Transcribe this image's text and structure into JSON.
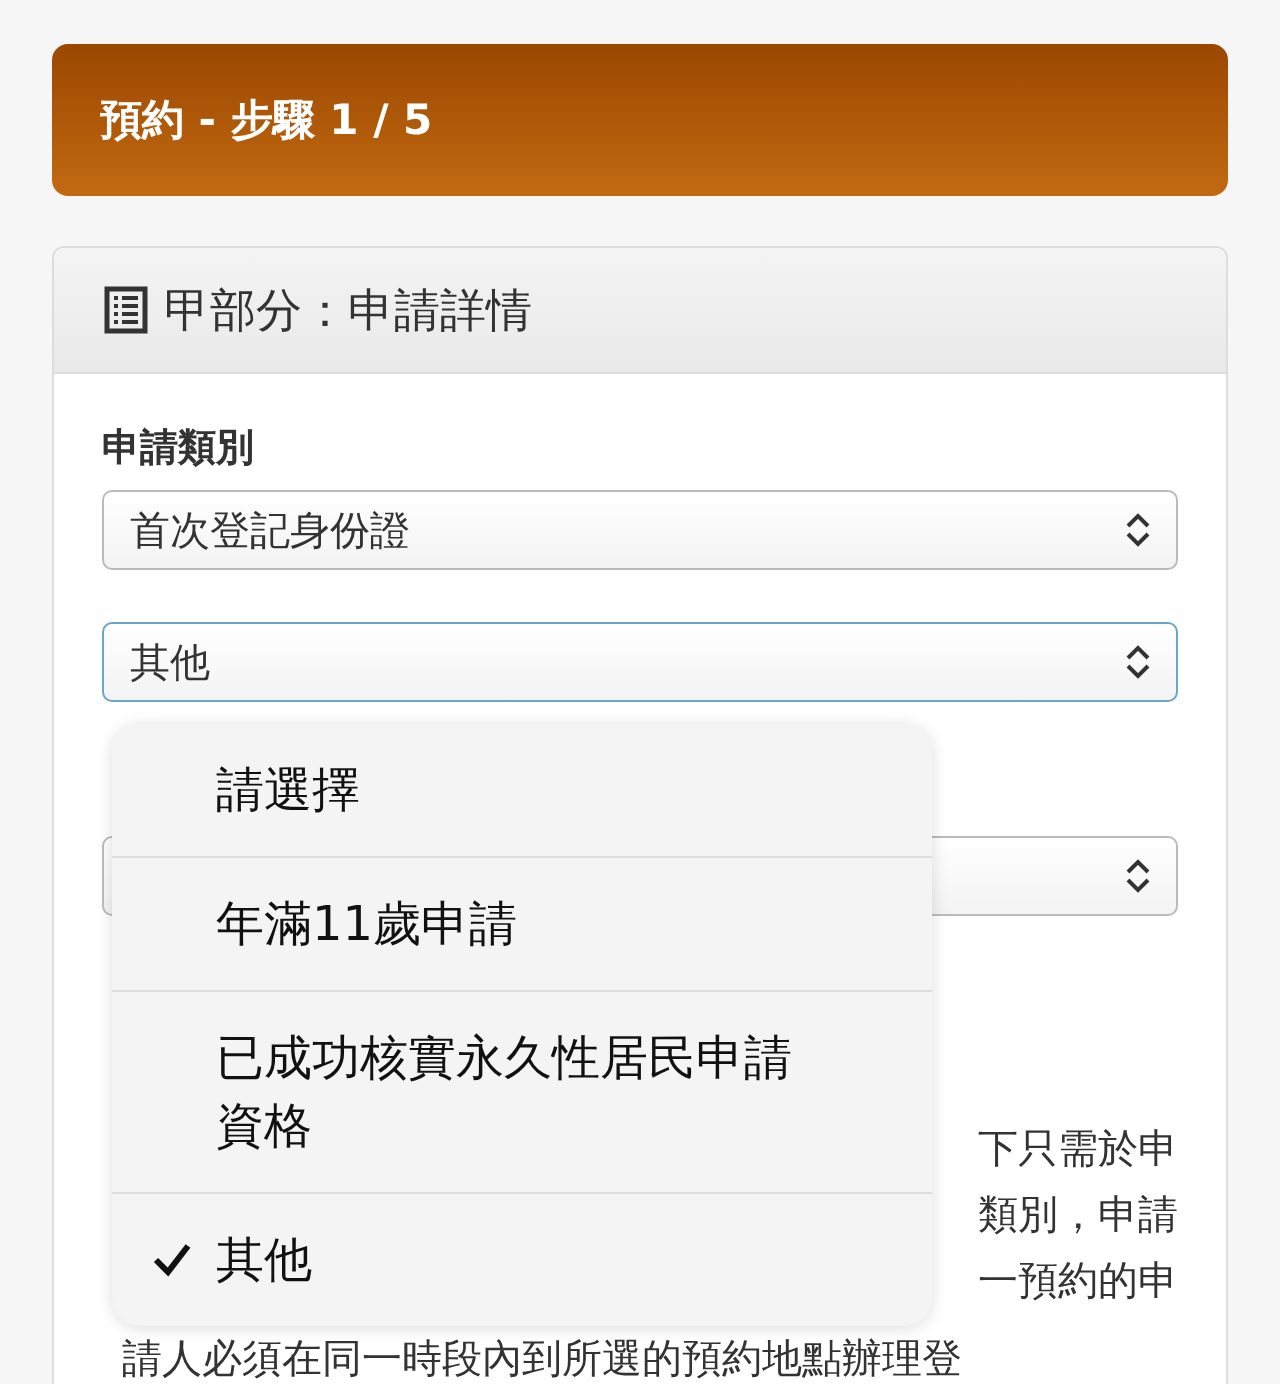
{
  "banner": {
    "title": "預約 - 步驟 1 / 5"
  },
  "section": {
    "title": "甲部分：申請詳情",
    "category": {
      "label": "申請類別",
      "value": "首次登記身份證"
    },
    "subcategory": {
      "value": "其他",
      "focused": true
    },
    "paragraph_fragments": [
      "下只需於申",
      "類別，申請",
      "一預約的申",
      "請人必須在同一時段內到所選的預約地點辦理登"
    ]
  },
  "dropdown": {
    "options": [
      {
        "label": "請選擇",
        "selected": false
      },
      {
        "label": "年滿11歲申請",
        "selected": false
      },
      {
        "label": "已成功核實永久性居民申請資格",
        "selected": false
      },
      {
        "label": "其他",
        "selected": true
      }
    ]
  }
}
